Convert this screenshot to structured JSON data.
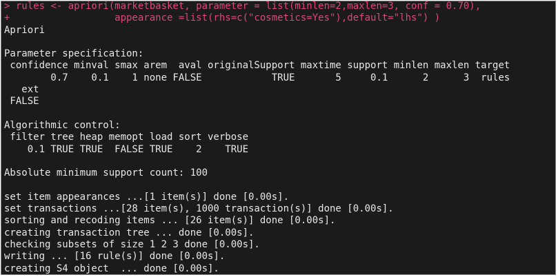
{
  "command": {
    "line1": "> rules <- apriori(marketbasket, parameter = list(minlen=2,maxlen=3, conf = 0.70),",
    "line2": "+                  appearance =list(rhs=c(\"cosmetics=Yes\"),default=\"lhs\") )"
  },
  "output": {
    "algorithm": "Apriori",
    "param_heading": "Parameter specification:",
    "param_header_row": " confidence minval smax arem  aval originalSupport maxtime support minlen maxlen target",
    "param_value_row": "        0.7    0.1    1 none FALSE            TRUE       5     0.1      2      3  rules",
    "param_ext_header": "   ext",
    "param_ext_value": " FALSE",
    "control_heading": "Algorithmic control:",
    "control_header_row": " filter tree heap memopt load sort verbose",
    "control_value_row": "    0.1 TRUE TRUE  FALSE TRUE    2    TRUE",
    "support_count": "Absolute minimum support count: 100",
    "log": [
      "set item appearances ...[1 item(s)] done [0.00s].",
      "set transactions ...[28 item(s), 1000 transaction(s)] done [0.00s].",
      "sorting and recoding items ... [26 item(s)] done [0.00s].",
      "creating transaction tree ... done [0.00s].",
      "checking subsets of size 1 2 3 done [0.00s].",
      "writing ... [16 rule(s)] done [0.00s].",
      "creating S4 object  ... done [0.00s]."
    ]
  }
}
